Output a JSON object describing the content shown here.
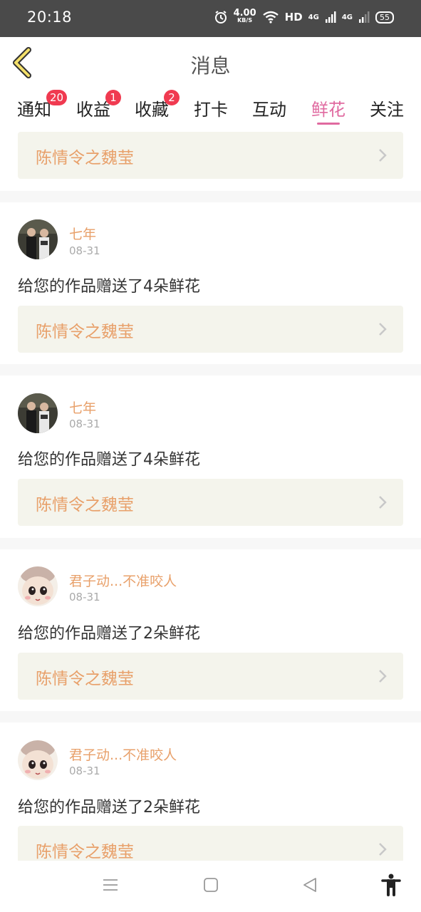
{
  "status": {
    "time": "20:18",
    "net_speed": "4.00",
    "net_unit": "KB/S",
    "hd": "HD",
    "net_4g_a": "4G",
    "net_4g_b": "4G",
    "battery": "55",
    "icons": [
      "alarm-icon",
      "wifi-icon",
      "signal-icon",
      "battery-icon"
    ]
  },
  "header": {
    "title": "消息"
  },
  "tabs": [
    {
      "label": "通知",
      "badge": "20"
    },
    {
      "label": "收益",
      "badge": "1"
    },
    {
      "label": "收藏",
      "badge": "2"
    },
    {
      "label": "打卡"
    },
    {
      "label": "互动"
    },
    {
      "label": "鲜花",
      "active": true
    },
    {
      "label": "关注"
    }
  ],
  "top_work": {
    "title": "陈情令之魏莹"
  },
  "messages": [
    {
      "user": "七年",
      "date": "08-31",
      "text": "给您的作品赠送了4朵鲜花",
      "work": "陈情令之魏莹"
    },
    {
      "user": "七年",
      "date": "08-31",
      "text": "给您的作品赠送了4朵鲜花",
      "work": "陈情令之魏莹"
    },
    {
      "user": "君子动...不准咬人",
      "date": "08-31",
      "text": "给您的作品赠送了2朵鲜花",
      "work": "陈情令之魏莹"
    },
    {
      "user": "君子动...不准咬人",
      "date": "08-31",
      "text": "给您的作品赠送了2朵鲜花",
      "work": "陈情令之魏莹"
    }
  ],
  "colors": {
    "accent_pink": "#e06aa0",
    "badge_red": "#f03a50",
    "work_title": "#e8a06a",
    "work_bg": "#f4f4ec"
  }
}
